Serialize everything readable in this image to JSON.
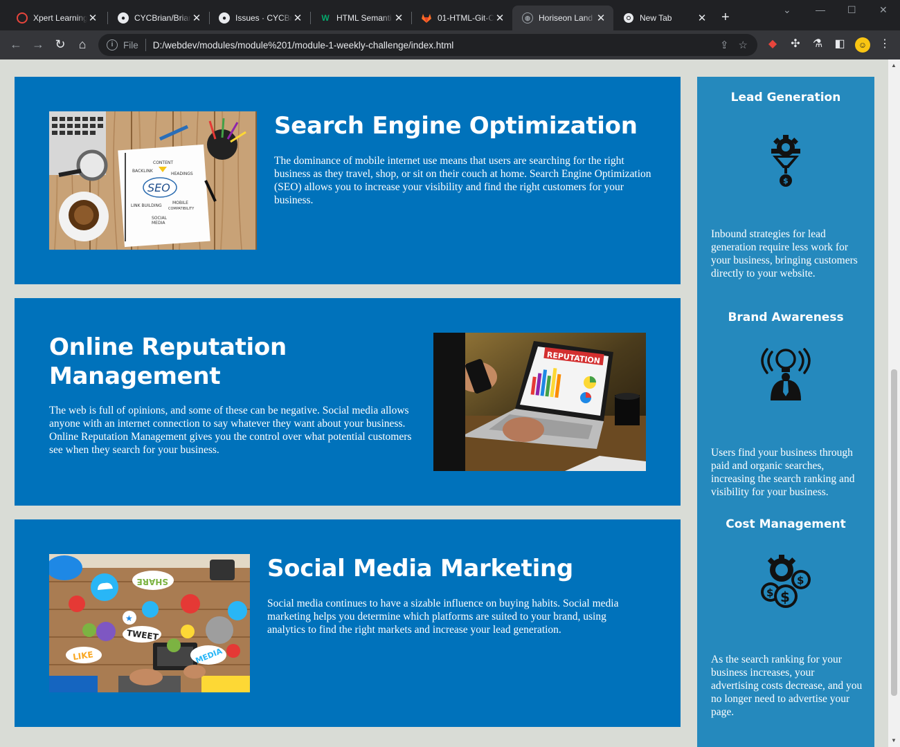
{
  "browser": {
    "tabs": [
      {
        "title": "Xpert Learning",
        "icon": "xpert-icon",
        "active": false
      },
      {
        "title": "CYCBrian/Brian",
        "icon": "github-icon",
        "active": false
      },
      {
        "title": "Issues · CYCBri",
        "icon": "github-icon",
        "active": false
      },
      {
        "title": "HTML Semanti",
        "icon": "w3-icon",
        "active": false
      },
      {
        "title": "01-HTML-Git-C",
        "icon": "gitlab-icon",
        "active": false
      },
      {
        "title": "Horiseon Land",
        "icon": "globe-icon",
        "active": true
      },
      {
        "title": "New Tab",
        "icon": "chrome-icon",
        "active": false
      }
    ],
    "address": {
      "scheme": "File",
      "url": "D:/webdev/modules/module%201/module-1-weekly-challenge/index.html"
    }
  },
  "services": [
    {
      "title": "Search Engine Optimization",
      "body": "The dominance of mobile internet use means that users are searching for the right business as they travel, shop, or sit on their couch at home. Search Engine Optimization (SEO) allows you to increase your visibility and find the right customers for your business.",
      "image_labels": {
        "center": "SEO",
        "content": "CONTENT",
        "backlink": "BACKLINK",
        "headings": "HEADINGS",
        "link_building": "LINK BUILDING",
        "mobile": "MOBILE",
        "compat": "COMPATIBILITY",
        "social": "SOCIAL",
        "media": "MEDIA"
      }
    },
    {
      "title": "Online Reputation Management",
      "title_line1": "Online Reputation",
      "title_line2": "Management",
      "body": "The web is full of opinions, and some of these can be negative. Social media allows anyone with an internet connection to say whatever they want about your business. Online Reputation Management gives you the control over what potential customers see when they search for your business.",
      "image_labels": {
        "banner": "REPUTATION"
      }
    },
    {
      "title": "Social Media Marketing",
      "body": "Social media continues to have a sizable influence on buying habits. Social media marketing helps you determine which platforms are suited to your brand, using analytics to find the right markets and increase your lead generation.",
      "image_labels": {
        "share": "SHARE",
        "tweet": "TWEET",
        "like": "LIKE",
        "media": "MEDIA"
      }
    }
  ],
  "benefits": [
    {
      "title": "Lead Generation",
      "icon": "lead-generation-icon",
      "body": "Inbound strategies for lead generation require less work for your business, bringing customers directly to your website."
    },
    {
      "title": "Brand Awareness",
      "icon": "brand-awareness-icon",
      "body": "Users find your business through paid and organic searches, increasing the search ranking and visibility for your business."
    },
    {
      "title": "Cost Management",
      "icon": "cost-management-icon",
      "body": "As the search ranking for your business increases, your advertising costs decrease, and you no longer need to advertise your page."
    }
  ],
  "colors": {
    "page_bg": "#d9dcd6",
    "card_bg": "#0072bb",
    "sidebar_bg": "#2589bd",
    "text": "#ffffff"
  }
}
